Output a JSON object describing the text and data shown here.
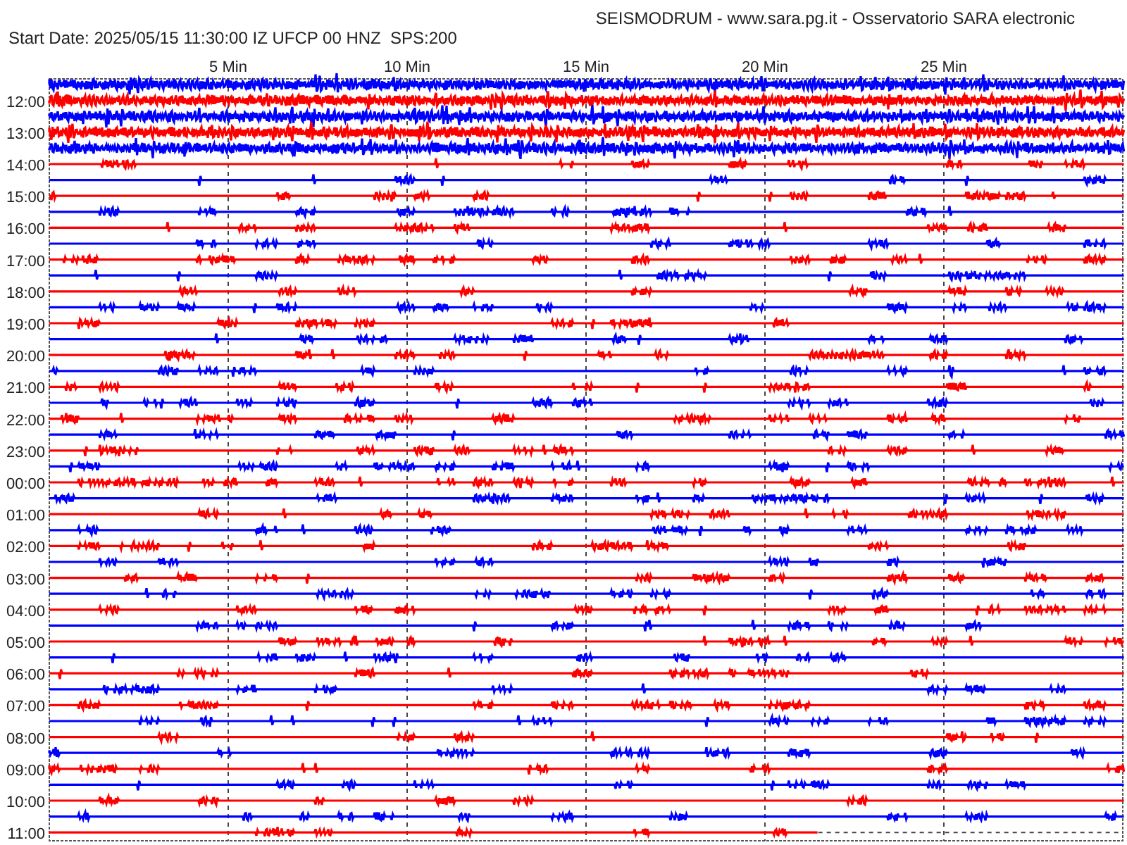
{
  "header": {
    "title": "SEISMODRUM - www.sara.pg.it - Osservatorio SARA electronic",
    "info": "Start Date: 2025/05/15 11:30:00 IZ UFCP 00 HNZ  SPS:200"
  },
  "x_ticks": [
    "5 Min",
    "10 Min",
    "15 Min",
    "20 Min",
    "25 Min"
  ],
  "traces": [
    {
      "color": "#0000ff",
      "kind": "noisy"
    },
    {
      "time": "12:00",
      "color": "#ff0000",
      "kind": "noisy"
    },
    {
      "color": "#0000ff",
      "kind": "noisy"
    },
    {
      "time": "13:00",
      "color": "#ff0000",
      "kind": "noisy"
    },
    {
      "color": "#0000ff",
      "kind": "noisy"
    },
    {
      "time": "14:00",
      "color": "#ff0000",
      "kind": "quiet"
    },
    {
      "color": "#0000ff",
      "kind": "quiet"
    },
    {
      "time": "15:00",
      "color": "#ff0000",
      "kind": "quiet"
    },
    {
      "color": "#0000ff",
      "kind": "quiet"
    },
    {
      "time": "16:00",
      "color": "#ff0000",
      "kind": "quiet"
    },
    {
      "color": "#0000ff",
      "kind": "quiet"
    },
    {
      "time": "17:00",
      "color": "#ff0000",
      "kind": "quiet"
    },
    {
      "color": "#0000ff",
      "kind": "quiet"
    },
    {
      "time": "18:00",
      "color": "#ff0000",
      "kind": "quiet"
    },
    {
      "color": "#0000ff",
      "kind": "quiet"
    },
    {
      "time": "19:00",
      "color": "#ff0000",
      "kind": "quiet"
    },
    {
      "color": "#0000ff",
      "kind": "quiet"
    },
    {
      "time": "20:00",
      "color": "#ff0000",
      "kind": "quiet"
    },
    {
      "color": "#0000ff",
      "kind": "quiet"
    },
    {
      "time": "21:00",
      "color": "#ff0000",
      "kind": "quiet"
    },
    {
      "color": "#0000ff",
      "kind": "quiet"
    },
    {
      "time": "22:00",
      "color": "#ff0000",
      "kind": "quiet"
    },
    {
      "color": "#0000ff",
      "kind": "quiet"
    },
    {
      "time": "23:00",
      "color": "#ff0000",
      "kind": "quiet"
    },
    {
      "color": "#0000ff",
      "kind": "quiet"
    },
    {
      "time": "00:00",
      "color": "#ff0000",
      "kind": "quiet"
    },
    {
      "color": "#0000ff",
      "kind": "quiet"
    },
    {
      "time": "01:00",
      "color": "#ff0000",
      "kind": "quiet"
    },
    {
      "color": "#0000ff",
      "kind": "quiet"
    },
    {
      "time": "02:00",
      "color": "#ff0000",
      "kind": "quiet"
    },
    {
      "color": "#0000ff",
      "kind": "quiet"
    },
    {
      "time": "03:00",
      "color": "#ff0000",
      "kind": "quiet"
    },
    {
      "color": "#0000ff",
      "kind": "quiet"
    },
    {
      "time": "04:00",
      "color": "#ff0000",
      "kind": "quiet"
    },
    {
      "color": "#0000ff",
      "kind": "quiet"
    },
    {
      "time": "05:00",
      "color": "#ff0000",
      "kind": "quiet"
    },
    {
      "color": "#0000ff",
      "kind": "quiet"
    },
    {
      "time": "06:00",
      "color": "#ff0000",
      "kind": "quiet"
    },
    {
      "color": "#0000ff",
      "kind": "quiet"
    },
    {
      "time": "07:00",
      "color": "#ff0000",
      "kind": "quiet"
    },
    {
      "color": "#0000ff",
      "kind": "quiet"
    },
    {
      "time": "08:00",
      "color": "#ff0000",
      "kind": "quiet"
    },
    {
      "color": "#0000ff",
      "kind": "quiet"
    },
    {
      "time": "09:00",
      "color": "#ff0000",
      "kind": "quiet"
    },
    {
      "color": "#0000ff",
      "kind": "quiet"
    },
    {
      "time": "10:00",
      "color": "#ff0000",
      "kind": "quiet"
    },
    {
      "color": "#0000ff",
      "kind": "quiet"
    },
    {
      "time": "11:00",
      "color": "#ff0000",
      "kind": "partial"
    }
  ]
}
